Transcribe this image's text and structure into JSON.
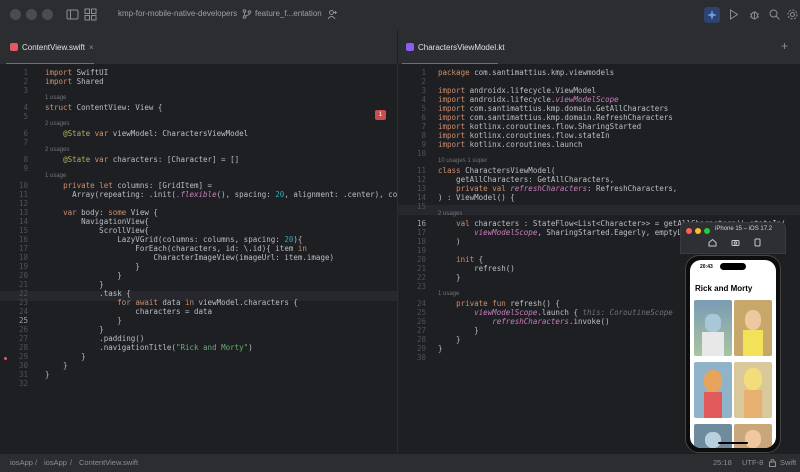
{
  "titlebar": {
    "project": "kmp-for-mobile-native-developers",
    "branch": "feature_f...entation"
  },
  "left_tab": {
    "label": "ContentView.swift",
    "error_count": "1"
  },
  "right_tab": {
    "label": "CharactersViewModel.kt"
  },
  "left_code": {
    "lines": [
      {
        "n": "1",
        "code": "import SwiftUI"
      },
      {
        "n": "2",
        "code": "import Shared"
      },
      {
        "n": "3",
        "code": ""
      },
      {
        "n": "4",
        "code": "struct ContentView: View {",
        "usage": "1 usage"
      },
      {
        "n": "5",
        "code": ""
      },
      {
        "n": "6",
        "code": "    @State var viewModel: CharactersViewModel",
        "usage": "2 usages"
      },
      {
        "n": "7",
        "code": ""
      },
      {
        "n": "8",
        "code": "    @State var characters: [Character] = []",
        "usage": "2 usages"
      },
      {
        "n": "9",
        "code": ""
      },
      {
        "n": "10",
        "code": "    private let columns: [GridItem] =",
        "usage": "1 usage"
      },
      {
        "n": "11",
        "code": "      Array(repeating: .init(.flexible(), spacing: 20, alignment: .center), co"
      },
      {
        "n": "12",
        "code": ""
      },
      {
        "n": "13",
        "code": "    var body: some View {"
      },
      {
        "n": "14",
        "code": "        NavigationView{"
      },
      {
        "n": "15",
        "code": "            ScrollView{"
      },
      {
        "n": "16",
        "code": "                LazyVGrid(columns: columns, spacing: 20){"
      },
      {
        "n": "17",
        "code": "                    ForEach(characters, id: \\.id){ item in"
      },
      {
        "n": "18",
        "code": "                        CharacterImageView(imageUrl: item.image)"
      },
      {
        "n": "19",
        "code": "                    }"
      },
      {
        "n": "20",
        "code": "                }"
      },
      {
        "n": "21",
        "code": "            }"
      },
      {
        "n": "22",
        "code": "            .task {"
      },
      {
        "n": "23",
        "code": "                for await data in viewModel.characters {"
      },
      {
        "n": "24",
        "code": "                    characters = data"
      },
      {
        "n": "25",
        "code": "                }"
      },
      {
        "n": "26",
        "code": "            }"
      },
      {
        "n": "27",
        "code": "            .padding()"
      },
      {
        "n": "28",
        "code": "            .navigationTitle(\"Rick and Morty\")"
      },
      {
        "n": "29",
        "code": "        }"
      },
      {
        "n": "30",
        "code": "    }"
      },
      {
        "n": "31",
        "code": "}"
      },
      {
        "n": "32",
        "code": ""
      }
    ]
  },
  "right_code": {
    "lines": [
      {
        "n": "1",
        "code": "package com.santimattius.kmp.viewmodels"
      },
      {
        "n": "2",
        "code": ""
      },
      {
        "n": "3",
        "code": "import androidx.lifecycle.ViewModel"
      },
      {
        "n": "4",
        "code": "import androidx.lifecycle.viewModelScope"
      },
      {
        "n": "5",
        "code": "import com.santimattius.kmp.domain.GetAllCharacters"
      },
      {
        "n": "6",
        "code": "import com.santimattius.kmp.domain.RefreshCharacters"
      },
      {
        "n": "7",
        "code": "import kotlinx.coroutines.flow.SharingStarted"
      },
      {
        "n": "8",
        "code": "import kotlinx.coroutines.flow.stateIn"
      },
      {
        "n": "9",
        "code": "import kotlinx.coroutines.launch"
      },
      {
        "n": "10",
        "code": ""
      },
      {
        "n": "11",
        "code": "class CharactersViewModel(",
        "usage": "10 usages  1 super"
      },
      {
        "n": "12",
        "code": "    getAllCharacters: GetAllCharacters,"
      },
      {
        "n": "13",
        "code": "    private val refreshCharacters: RefreshCharacters,"
      },
      {
        "n": "14",
        "code": ") : ViewModel() {"
      },
      {
        "n": "15",
        "code": ""
      },
      {
        "n": "16",
        "code": "    val characters : StateFlow<List<Character>> = getAllCharacters().stateIn(",
        "usage": "2 usages"
      },
      {
        "n": "17",
        "code": "        viewModelScope, SharingStarted.Eagerly, emptyList()"
      },
      {
        "n": "18",
        "code": "    )"
      },
      {
        "n": "19",
        "code": ""
      },
      {
        "n": "20",
        "code": "    init {"
      },
      {
        "n": "21",
        "code": "        refresh()"
      },
      {
        "n": "22",
        "code": "    }"
      },
      {
        "n": "23",
        "code": ""
      },
      {
        "n": "24",
        "code": "    private fun refresh() {",
        "usage": "1 usage"
      },
      {
        "n": "25",
        "code": "        viewModelScope.launch { this: CoroutineScope"
      },
      {
        "n": "26",
        "code": "            refreshCharacters.invoke()"
      },
      {
        "n": "27",
        "code": "        }"
      },
      {
        "n": "28",
        "code": "    }"
      },
      {
        "n": "29",
        "code": "}"
      },
      {
        "n": "30",
        "code": ""
      }
    ]
  },
  "simulator": {
    "title": "iPhone 15 – iOS 17.2",
    "time": "20:43",
    "nav_title": "Rick and Morty"
  },
  "statusbar": {
    "path": [
      "iosApp",
      "iosApp",
      "ContentView.swift"
    ],
    "position": "25:18",
    "encoding": "UTF-8",
    "language": "Swift"
  },
  "colors": {
    "accent": "#3574f0",
    "error": "#e55765",
    "background": "#1e1f22"
  }
}
